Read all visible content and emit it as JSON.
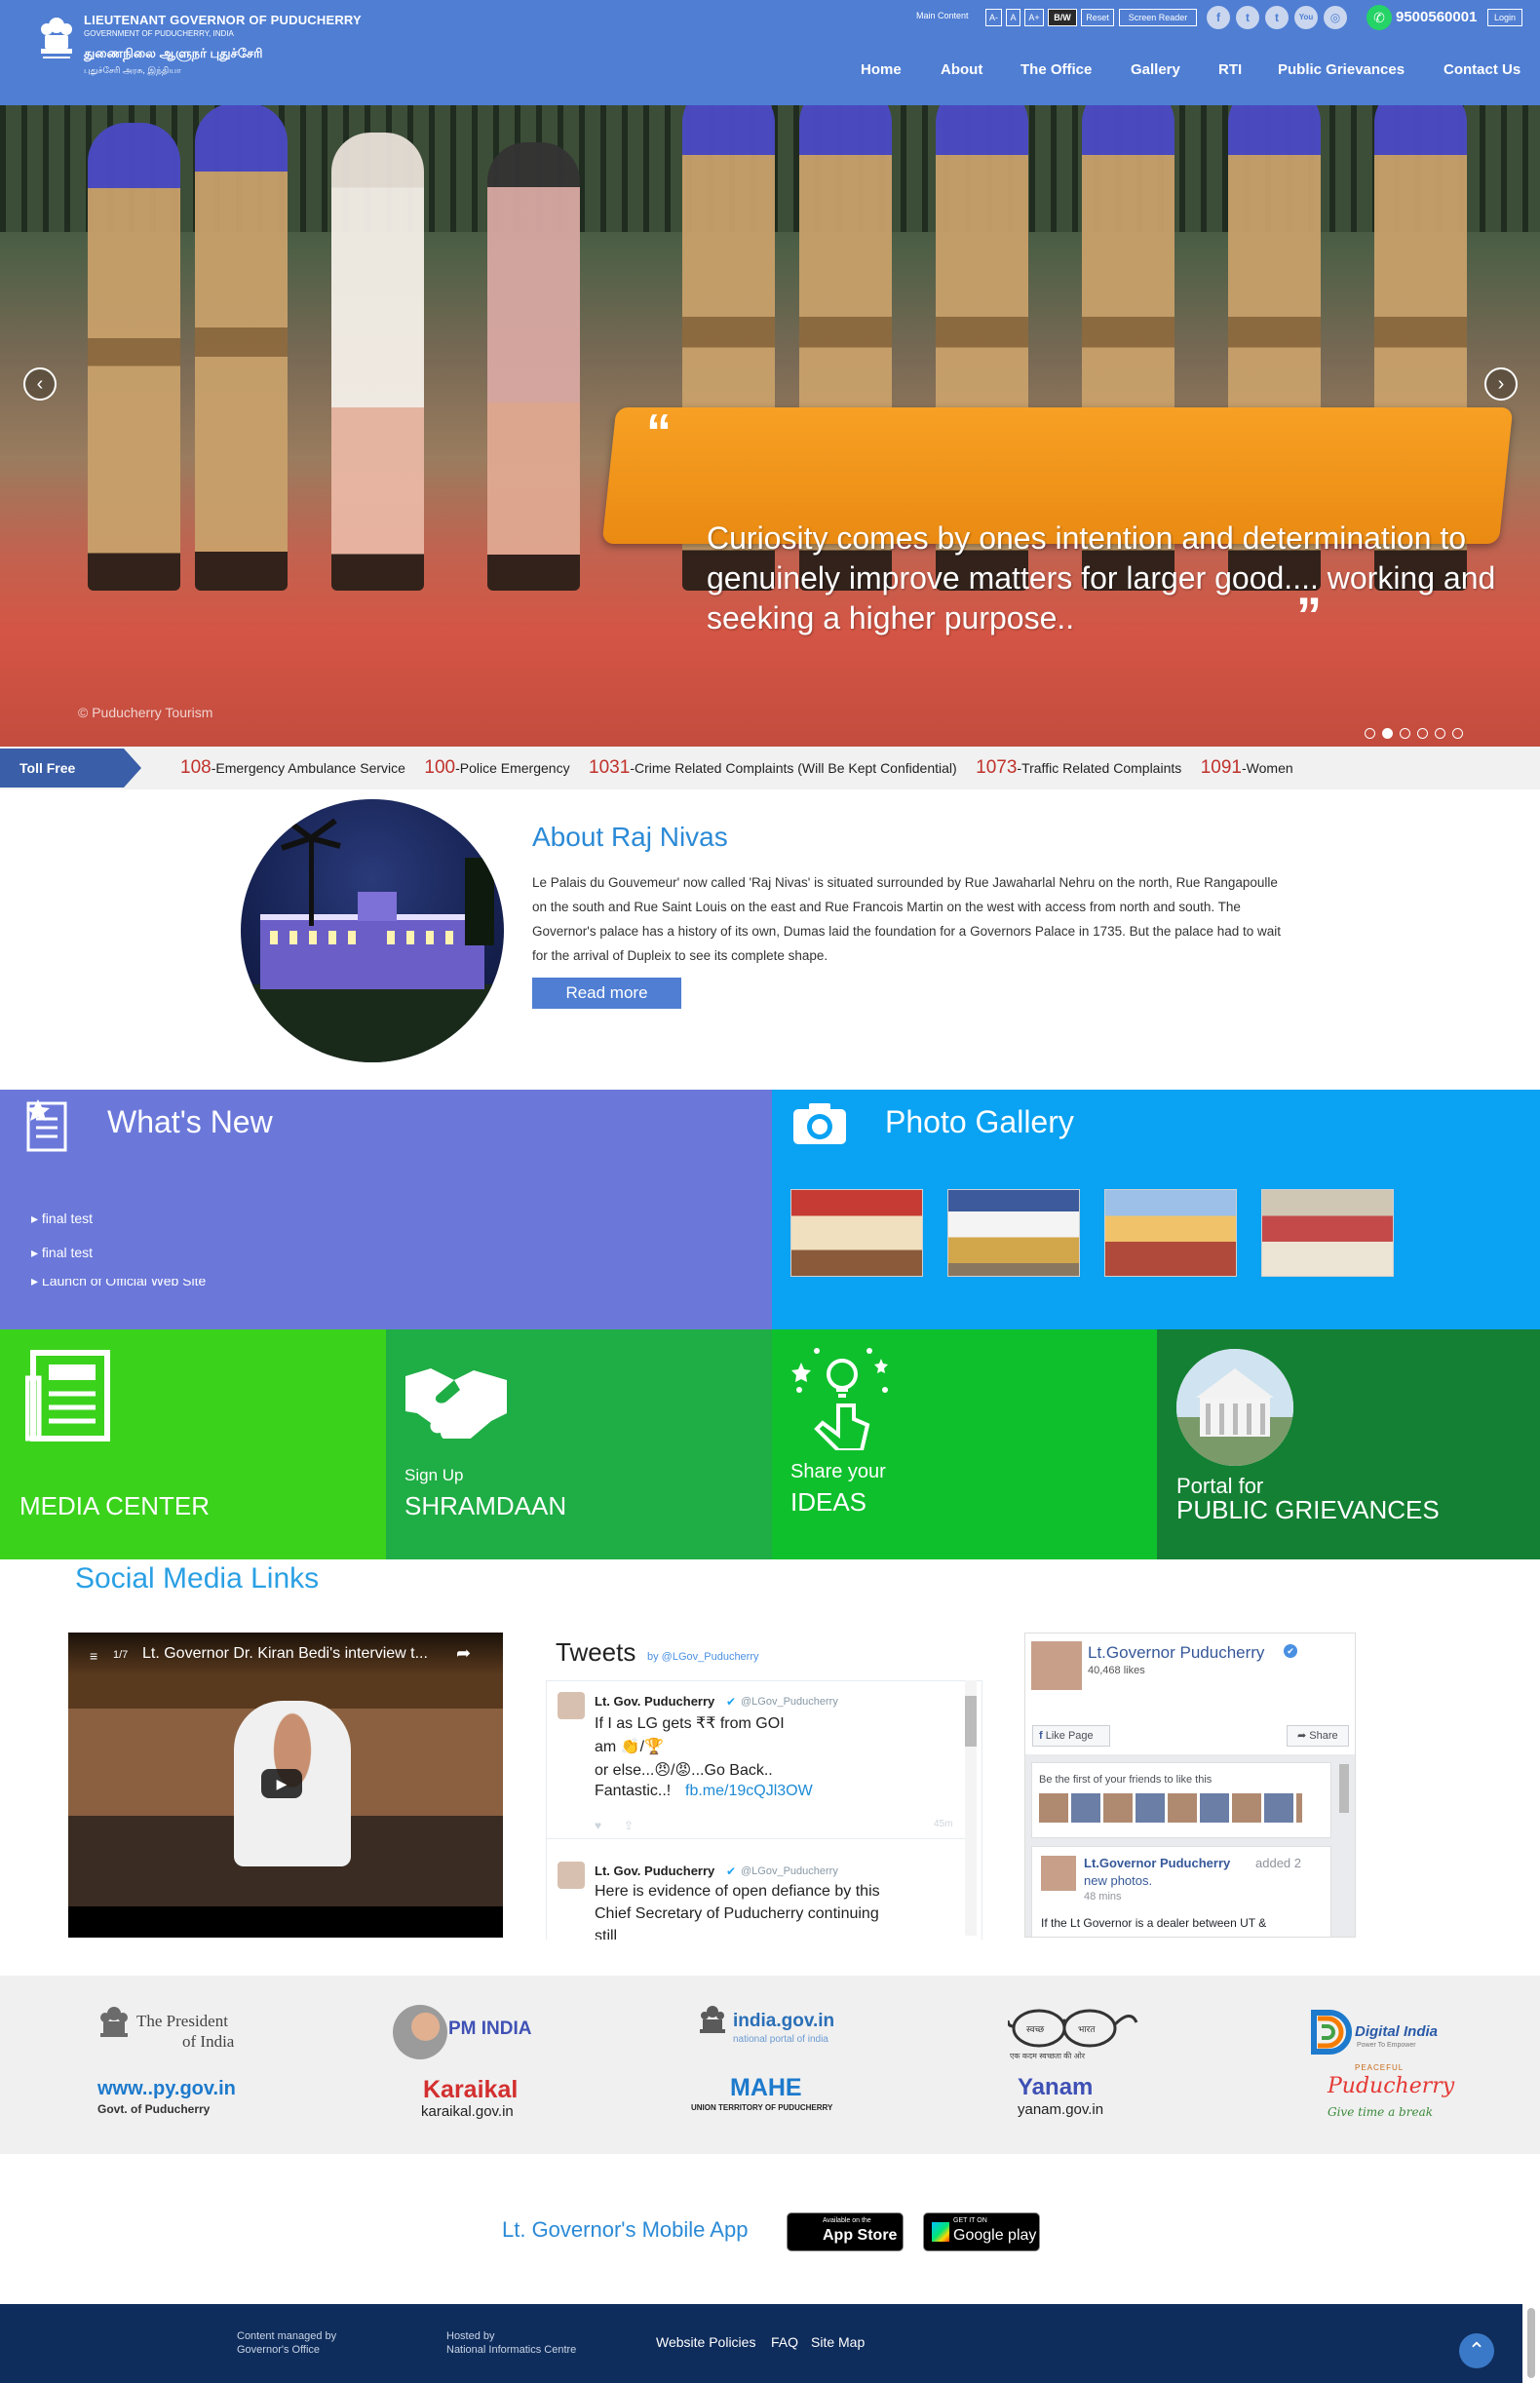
{
  "header": {
    "title": "LIEUTENANT GOVERNOR OF PUDUCHERRY",
    "subtitle": "GOVERNMENT OF PUDUCHERRY, INDIA",
    "tamil_title": "துணைநிலை ஆளுநர் புதுச்சேரி",
    "tamil_subtitle": "புதுச்சேரி அரசு, இந்தியா",
    "main_content": "Main Content",
    "font_minus": "A-",
    "font_normal": "A",
    "font_plus": "A+",
    "bw": "B/W",
    "reset": "Reset",
    "screen_reader": "Screen Reader",
    "social": {
      "facebook": "f",
      "twitter": "t",
      "tumblr": "t",
      "youtube": "You",
      "instagram": "◎"
    },
    "whatsapp": "9500560001",
    "login": "Login"
  },
  "nav": [
    "Home",
    "About",
    "The Office",
    "Gallery",
    "RTI",
    "Public Grievances",
    "Contact Us"
  ],
  "hero": {
    "quote": "Curiosity comes by ones intention and determination to genuinely improve matters for larger good.... working and seeking a higher purpose..",
    "credit": "© Puducherry Tourism",
    "prev": "‹",
    "next": "›",
    "slides": 6,
    "active_slide": 1
  },
  "ticker": {
    "label": "Toll Free",
    "items": [
      {
        "num": "108",
        "text": "Emergency Ambulance Service"
      },
      {
        "num": "100",
        "text": "Police Emergency"
      },
      {
        "num": "1031",
        "text": "Crime Related Complaints (Will Be Kept Confidential)"
      },
      {
        "num": "1073",
        "text": "Traffic Related Complaints"
      },
      {
        "num": "1091",
        "text": "Women"
      }
    ]
  },
  "about": {
    "title": "About Raj Nivas",
    "text": "Le Palais du Gouvemeur' now called 'Raj Nivas' is situated surrounded by Rue Jawaharlal Nehru on the north, Rue Rangapoulle on the south and Rue Saint Louis on the east and Rue Francois Martin on the west with access from north and south. The Governor's palace has a history of its own, Dumas laid the foundation for a Governors Palace in 1735. But the palace had to wait for the arrival of Dupleix to see its complete shape.",
    "read_more": "Read more"
  },
  "whats_new": {
    "title": "What's New",
    "items": [
      "final test",
      "final test",
      "Launch of Official Web Site"
    ]
  },
  "gallery": {
    "title": "Photo Gallery"
  },
  "tiles": [
    {
      "sub": "",
      "title": "MEDIA CENTER",
      "color": "#3bd21c"
    },
    {
      "sub": "Sign Up",
      "title": "SHRAMDAAN",
      "color": "#1fad45"
    },
    {
      "sub": "Share your",
      "title": "IDEAS",
      "color": "#0fc02d"
    },
    {
      "sub": "Portal for",
      "title": "PUBLIC GRIEVANCES",
      "color": "#148033"
    }
  ],
  "social": {
    "title": "Social Media Links",
    "video": {
      "counter": "1/7",
      "title": "Lt. Governor Dr. Kiran Bedi's interview t..."
    },
    "tweets": {
      "title": "Tweets",
      "by": "by @LGov_Puducherry",
      "items": [
        {
          "name": "Lt. Gov. Puducherry",
          "handle": "@LGov_Puducherry",
          "line1": "If I as LG gets ₹₹ from GOI",
          "line2": "am 👏/🏆",
          "line3": "or else...😠/😡...Go Back..",
          "line4": "Fantastic..!",
          "link": "fb.me/19cQJl3OW",
          "time": "45m"
        },
        {
          "name": "Lt. Gov. Puducherry",
          "handle": "@LGov_Puducherry",
          "line1": "Here is evidence of open defiance by this",
          "line2": "Chief Secretary of Puducherry continuing",
          "line3": "still"
        }
      ]
    },
    "facebook": {
      "page": "Lt.Governor Puducherry",
      "likes": "40,468 likes",
      "like_page": "Like Page",
      "share": "Share",
      "friends": "Be the first of your friends to like this",
      "post_author": "Lt.Governor Puducherry",
      "post_action": "added 2",
      "post_action2": "new photos.",
      "post_time": "48 mins",
      "post_text": "If the Lt Governor is a dealer between UT &"
    }
  },
  "partners": [
    {
      "name": "The President",
      "name2": "of India",
      "label": "www..py.gov.in",
      "label2": "Govt. of Puducherry"
    },
    {
      "name": "PM INDIA",
      "label": "Karaikal",
      "label2": "karaikal.gov.in"
    },
    {
      "name": "india.gov.in",
      "name2": "national portal of india",
      "label": "MAHE",
      "label2": "UNION TERRITORY OF PUDUCHERRY"
    },
    {
      "name": "स्वच्छ भारत",
      "name2": "एक कदम स्वच्छता की ओर",
      "label": "Yanam",
      "label2": "yanam.gov.in"
    },
    {
      "name": "Digital India",
      "name2": "Power To Empower",
      "label": "Puducherry",
      "label2": "Give time a break",
      "label3": "PEACEFUL"
    }
  ],
  "app": {
    "title": "Lt. Governor's Mobile App",
    "appstore_small": "Available on the",
    "appstore": "App Store",
    "gplay_small": "GET IT ON",
    "gplay": "Google play"
  },
  "footer": {
    "managed": "Content managed by",
    "managed2": "Governor's Office",
    "hosted": "Hosted by",
    "hosted2": "National Informatics Centre",
    "links": [
      "Website Policies",
      "FAQ",
      "Site Map"
    ]
  }
}
